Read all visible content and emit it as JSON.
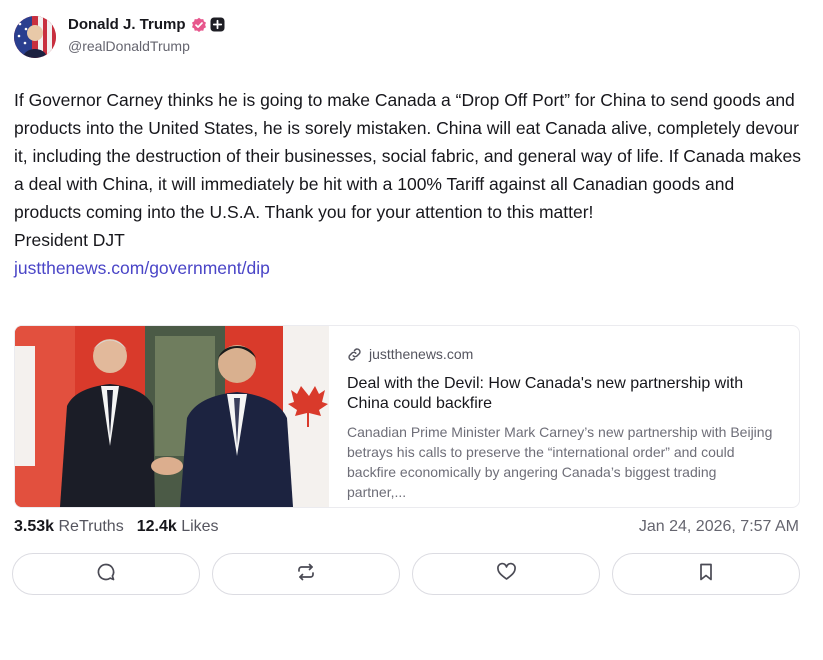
{
  "author": {
    "display_name": "Donald J. Trump",
    "handle": "@realDonaldTrump",
    "avatar_icon": "profile-photo",
    "verified_icon": "verified-badge-icon",
    "verified_color": "#e7578d"
  },
  "post": {
    "paragraph": "If Governor Carney thinks he is going to make Canada a “Drop Off Port” for China to send goods and products into the United States, he is sorely mistaken. China will eat Canada alive, completely devour it, including the destruction of their businesses, social fabric, and general way of life. If Canada makes a  deal with China, it will immediately be hit with a 100% Tariff against all Canadian goods and products coming into the U.S.A. Thank you for your attention to this matter!",
    "signature": "President DJT",
    "link_text": "justthenews.com/government/dip"
  },
  "link_card": {
    "domain": "justthenews.com",
    "title": "Deal with the Devil: How Canada's new partnership with China could backfire",
    "description": "Canadian Prime Minister Mark Carney’s new partnership with Beijing betrays his calls to preserve the “international order” and could backfire economically by angering Canada’s biggest trading partner,..."
  },
  "stats": {
    "retruths_count": "3.53k",
    "retruths_label": "ReTruths",
    "likes_count": "12.4k",
    "likes_label": "Likes",
    "timestamp": "Jan 24, 2026, 7:57 AM"
  },
  "actions": [
    {
      "name": "reply",
      "icon": "comment-icon"
    },
    {
      "name": "retruth",
      "icon": "repost-icon"
    },
    {
      "name": "like",
      "icon": "heart-icon"
    },
    {
      "name": "bookmark",
      "icon": "bookmark-icon"
    }
  ],
  "colors": {
    "link": "#4a45c7",
    "text": "#17171c",
    "muted": "#65656f"
  }
}
